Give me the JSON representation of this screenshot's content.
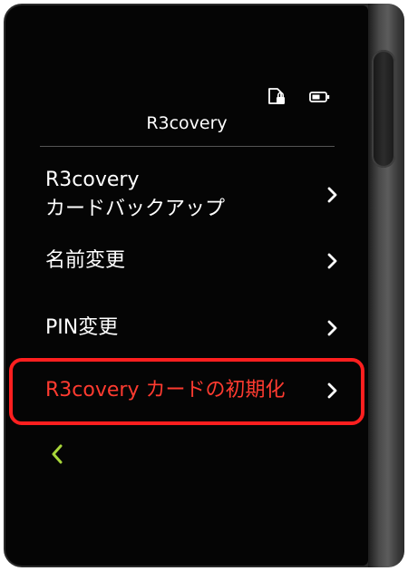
{
  "status": {
    "lock_icon": "sd-card-lock-icon",
    "battery_icon": "battery-icon"
  },
  "header": {
    "title": "R3covery"
  },
  "menu": {
    "items": [
      {
        "line1": "R3covery",
        "line2": "カードバックアップ",
        "icon": "chevron-right-icon"
      },
      {
        "label": "名前変更",
        "icon": "chevron-right-icon"
      },
      {
        "label": "PIN変更",
        "icon": "chevron-right-icon"
      },
      {
        "label": "R3covery カードの初期化",
        "icon": "chevron-right-icon",
        "highlighted": true
      }
    ]
  },
  "nav": {
    "back_icon": "chevron-left-icon"
  },
  "colors": {
    "screen_bg": "#050505",
    "text": "#ffffff",
    "danger_text": "#ff3b30",
    "highlight_border": "#ff1f1f",
    "back_accent": "#a8d63a"
  }
}
